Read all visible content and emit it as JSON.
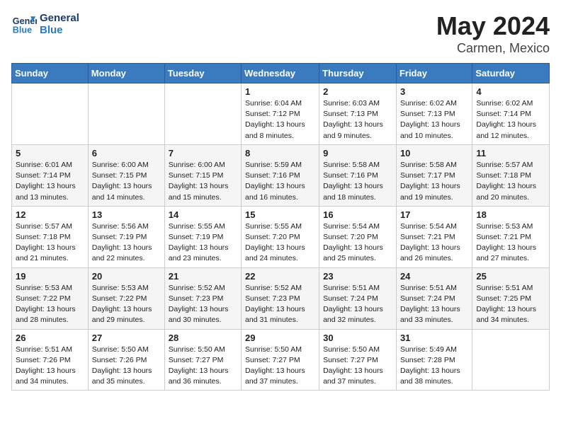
{
  "header": {
    "logo_general": "General",
    "logo_blue": "Blue",
    "month": "May 2024",
    "location": "Carmen, Mexico"
  },
  "weekdays": [
    "Sunday",
    "Monday",
    "Tuesday",
    "Wednesday",
    "Thursday",
    "Friday",
    "Saturday"
  ],
  "weeks": [
    [
      {
        "day": "",
        "info": ""
      },
      {
        "day": "",
        "info": ""
      },
      {
        "day": "",
        "info": ""
      },
      {
        "day": "1",
        "info": "Sunrise: 6:04 AM\nSunset: 7:12 PM\nDaylight: 13 hours\nand 8 minutes."
      },
      {
        "day": "2",
        "info": "Sunrise: 6:03 AM\nSunset: 7:13 PM\nDaylight: 13 hours\nand 9 minutes."
      },
      {
        "day": "3",
        "info": "Sunrise: 6:02 AM\nSunset: 7:13 PM\nDaylight: 13 hours\nand 10 minutes."
      },
      {
        "day": "4",
        "info": "Sunrise: 6:02 AM\nSunset: 7:14 PM\nDaylight: 13 hours\nand 12 minutes."
      }
    ],
    [
      {
        "day": "5",
        "info": "Sunrise: 6:01 AM\nSunset: 7:14 PM\nDaylight: 13 hours\nand 13 minutes."
      },
      {
        "day": "6",
        "info": "Sunrise: 6:00 AM\nSunset: 7:15 PM\nDaylight: 13 hours\nand 14 minutes."
      },
      {
        "day": "7",
        "info": "Sunrise: 6:00 AM\nSunset: 7:15 PM\nDaylight: 13 hours\nand 15 minutes."
      },
      {
        "day": "8",
        "info": "Sunrise: 5:59 AM\nSunset: 7:16 PM\nDaylight: 13 hours\nand 16 minutes."
      },
      {
        "day": "9",
        "info": "Sunrise: 5:58 AM\nSunset: 7:16 PM\nDaylight: 13 hours\nand 18 minutes."
      },
      {
        "day": "10",
        "info": "Sunrise: 5:58 AM\nSunset: 7:17 PM\nDaylight: 13 hours\nand 19 minutes."
      },
      {
        "day": "11",
        "info": "Sunrise: 5:57 AM\nSunset: 7:18 PM\nDaylight: 13 hours\nand 20 minutes."
      }
    ],
    [
      {
        "day": "12",
        "info": "Sunrise: 5:57 AM\nSunset: 7:18 PM\nDaylight: 13 hours\nand 21 minutes."
      },
      {
        "day": "13",
        "info": "Sunrise: 5:56 AM\nSunset: 7:19 PM\nDaylight: 13 hours\nand 22 minutes."
      },
      {
        "day": "14",
        "info": "Sunrise: 5:55 AM\nSunset: 7:19 PM\nDaylight: 13 hours\nand 23 minutes."
      },
      {
        "day": "15",
        "info": "Sunrise: 5:55 AM\nSunset: 7:20 PM\nDaylight: 13 hours\nand 24 minutes."
      },
      {
        "day": "16",
        "info": "Sunrise: 5:54 AM\nSunset: 7:20 PM\nDaylight: 13 hours\nand 25 minutes."
      },
      {
        "day": "17",
        "info": "Sunrise: 5:54 AM\nSunset: 7:21 PM\nDaylight: 13 hours\nand 26 minutes."
      },
      {
        "day": "18",
        "info": "Sunrise: 5:53 AM\nSunset: 7:21 PM\nDaylight: 13 hours\nand 27 minutes."
      }
    ],
    [
      {
        "day": "19",
        "info": "Sunrise: 5:53 AM\nSunset: 7:22 PM\nDaylight: 13 hours\nand 28 minutes."
      },
      {
        "day": "20",
        "info": "Sunrise: 5:53 AM\nSunset: 7:22 PM\nDaylight: 13 hours\nand 29 minutes."
      },
      {
        "day": "21",
        "info": "Sunrise: 5:52 AM\nSunset: 7:23 PM\nDaylight: 13 hours\nand 30 minutes."
      },
      {
        "day": "22",
        "info": "Sunrise: 5:52 AM\nSunset: 7:23 PM\nDaylight: 13 hours\nand 31 minutes."
      },
      {
        "day": "23",
        "info": "Sunrise: 5:51 AM\nSunset: 7:24 PM\nDaylight: 13 hours\nand 32 minutes."
      },
      {
        "day": "24",
        "info": "Sunrise: 5:51 AM\nSunset: 7:24 PM\nDaylight: 13 hours\nand 33 minutes."
      },
      {
        "day": "25",
        "info": "Sunrise: 5:51 AM\nSunset: 7:25 PM\nDaylight: 13 hours\nand 34 minutes."
      }
    ],
    [
      {
        "day": "26",
        "info": "Sunrise: 5:51 AM\nSunset: 7:26 PM\nDaylight: 13 hours\nand 34 minutes."
      },
      {
        "day": "27",
        "info": "Sunrise: 5:50 AM\nSunset: 7:26 PM\nDaylight: 13 hours\nand 35 minutes."
      },
      {
        "day": "28",
        "info": "Sunrise: 5:50 AM\nSunset: 7:27 PM\nDaylight: 13 hours\nand 36 minutes."
      },
      {
        "day": "29",
        "info": "Sunrise: 5:50 AM\nSunset: 7:27 PM\nDaylight: 13 hours\nand 37 minutes."
      },
      {
        "day": "30",
        "info": "Sunrise: 5:50 AM\nSunset: 7:27 PM\nDaylight: 13 hours\nand 37 minutes."
      },
      {
        "day": "31",
        "info": "Sunrise: 5:49 AM\nSunset: 7:28 PM\nDaylight: 13 hours\nand 38 minutes."
      },
      {
        "day": "",
        "info": ""
      }
    ]
  ]
}
